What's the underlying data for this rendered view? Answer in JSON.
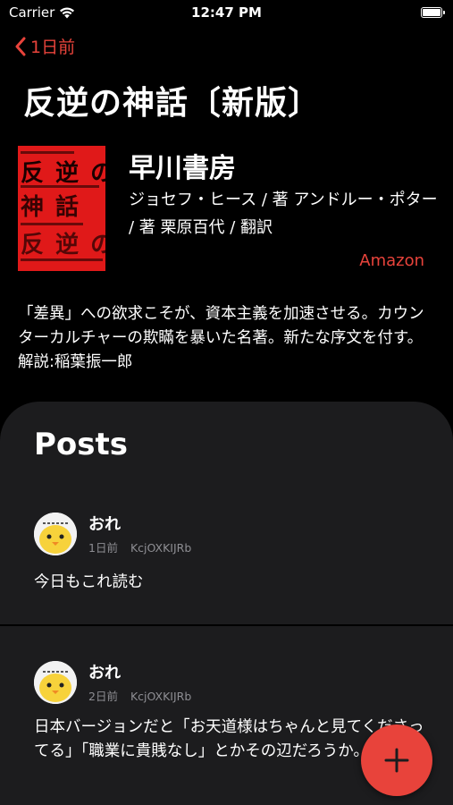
{
  "status_bar": {
    "carrier": "Carrier",
    "time": "12:47 PM",
    "icons": [
      "wifi-icon",
      "battery-icon"
    ]
  },
  "nav": {
    "back_label": "1日前"
  },
  "book": {
    "title": "反逆の神話〔新版〕",
    "publisher": "早川書房",
    "authors": "ジョセフ・ヒース / 著 アンドルー・ポター / 著 栗原百代 / 翻訳",
    "store_link": "Amazon",
    "description": "「差異」への欲求こそが、資本主義を加速させる。カウンターカルチャーの欺瞞を暴いた名著。新たな序文を付す。解説:稲葉振一郎"
  },
  "posts_section": {
    "heading": "Posts",
    "items": [
      {
        "author": "おれ",
        "time": "1日前",
        "user_id": "KcjOXKIJRb",
        "body": "今日もこれ読む"
      },
      {
        "author": "おれ",
        "time": "2日前",
        "user_id": "KcjOXKIJRb",
        "body": "日本バージョンだと「お天道様はちゃんと見てくださってる」「職業に貴賎なし」とかその辺だろうか。..."
      }
    ]
  },
  "fab": {
    "icon": "plus-icon"
  },
  "colors": {
    "accent": "#e8433b",
    "background": "#000000",
    "panel": "#1c1c1e",
    "meta_text": "#8e8e93"
  }
}
